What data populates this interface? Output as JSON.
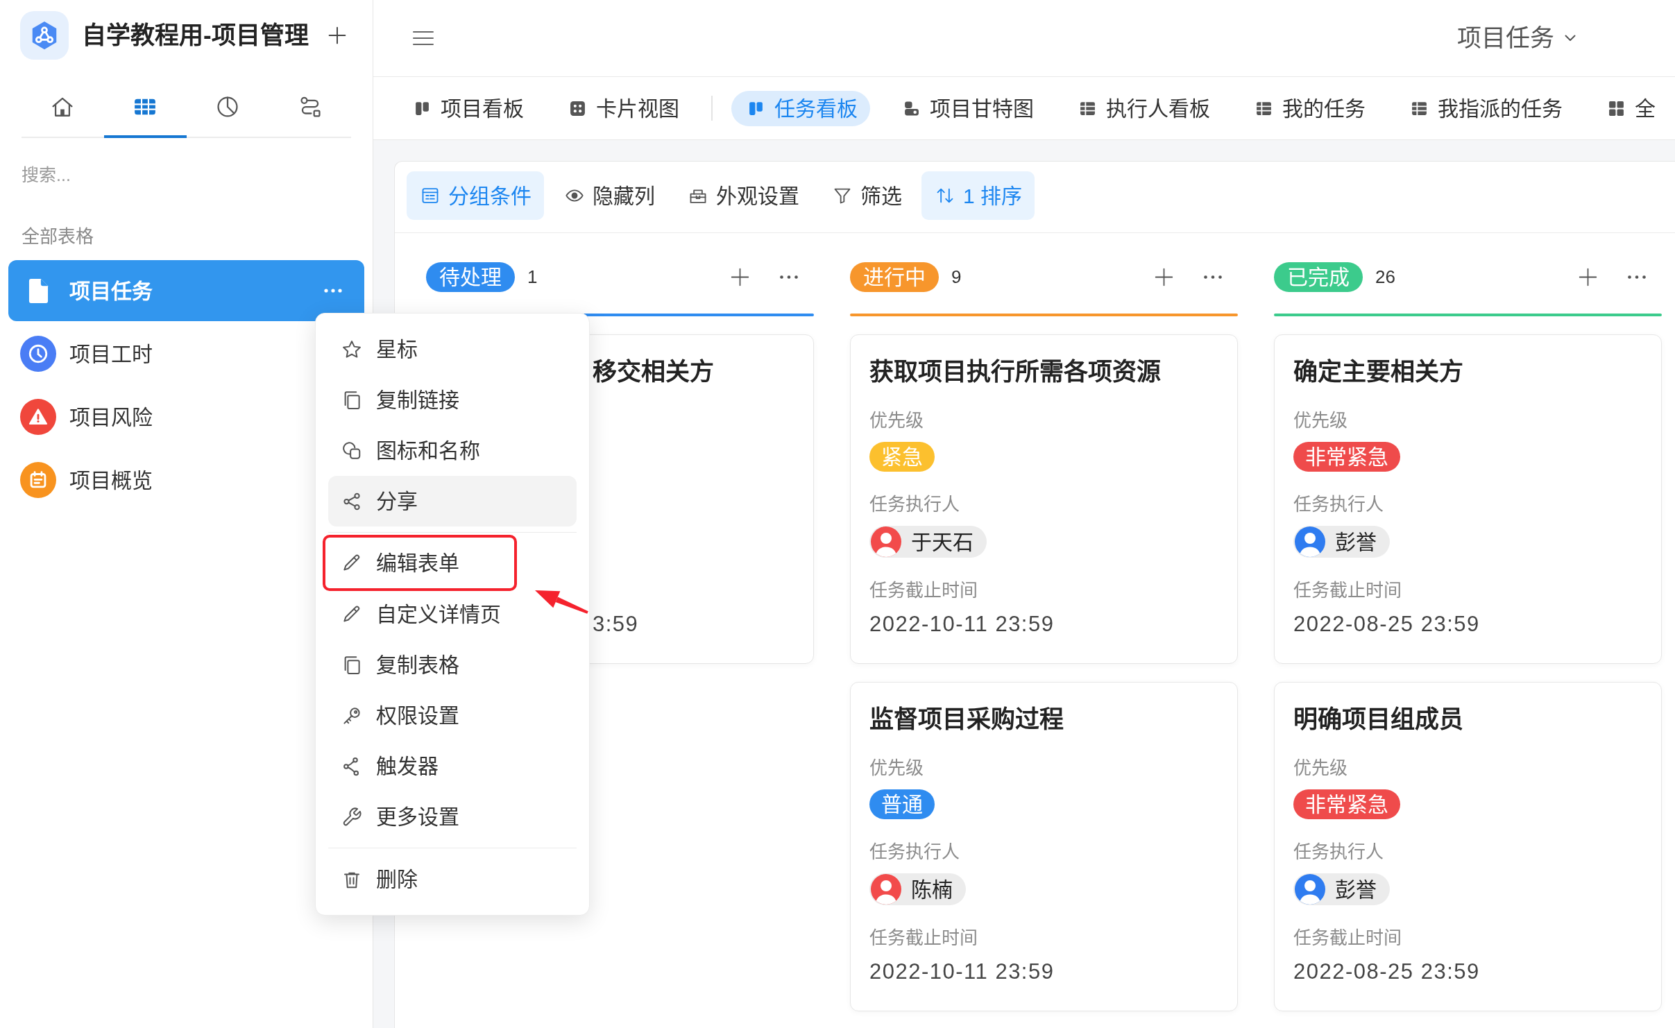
{
  "sidebar": {
    "app_title": "自学教程用-项目管理",
    "nav_tabs": [
      {
        "selected": false
      },
      {
        "selected": true
      },
      {
        "selected": false
      },
      {
        "selected": false
      }
    ],
    "search": {
      "placeholder": "搜索..."
    },
    "section_title": "全部表格",
    "items": [
      {
        "label": "项目任务",
        "selected": true
      },
      {
        "label": "项目工时",
        "selected": false,
        "color": "#4a7df5"
      },
      {
        "label": "项目风险",
        "selected": false,
        "color": "#f0473c"
      },
      {
        "label": "项目概览",
        "selected": false,
        "color": "#f8931f"
      }
    ]
  },
  "context_menu": {
    "sections": [
      [
        {
          "label": "星标",
          "hovered": false,
          "boxed": false
        },
        {
          "label": "复制链接",
          "hovered": false,
          "boxed": false
        },
        {
          "label": "图标和名称",
          "hovered": false,
          "boxed": false
        },
        {
          "label": "分享",
          "hovered": true,
          "boxed": false
        }
      ],
      [
        {
          "label": "编辑表单",
          "hovered": false,
          "boxed": true
        },
        {
          "label": "自定义详情页",
          "hovered": false,
          "boxed": false
        },
        {
          "label": "复制表格",
          "hovered": false,
          "boxed": false
        },
        {
          "label": "权限设置",
          "hovered": false,
          "boxed": false
        },
        {
          "label": "触发器",
          "hovered": false,
          "boxed": false
        },
        {
          "label": "更多设置",
          "hovered": false,
          "boxed": false
        }
      ],
      [
        {
          "label": "删除",
          "hovered": false,
          "boxed": false
        }
      ]
    ]
  },
  "topbar": {
    "table_selector": "项目任务"
  },
  "view_tab_groups": [
    [
      {
        "kind": "kanban",
        "label": "项目看板",
        "selected": false
      },
      {
        "kind": "gallery",
        "label": "卡片视图",
        "selected": false
      }
    ],
    [
      {
        "kind": "kanban",
        "label": "任务看板",
        "selected": true
      },
      {
        "kind": "gantt",
        "label": "项目甘特图",
        "selected": false
      },
      {
        "kind": "table",
        "label": "执行人看板",
        "selected": false
      },
      {
        "kind": "table",
        "label": "我的任务",
        "selected": false
      },
      {
        "kind": "table",
        "label": "我指派的任务",
        "selected": false
      },
      {
        "kind": "grid",
        "label": "全",
        "selected": false
      }
    ]
  ],
  "toolbar": [
    {
      "label": "分组条件",
      "active": true
    },
    {
      "label": "隐藏列",
      "active": false
    },
    {
      "label": "外观设置",
      "active": false
    },
    {
      "label": "筛选",
      "active": false
    },
    {
      "label": "1 排序",
      "active": true
    }
  ],
  "columns": [
    {
      "status": "待处理",
      "color": "#2f8cf0",
      "count": "1",
      "cards": [
        {
          "title": "移交相关方",
          "covered": true,
          "fields": [
            {
              "kind": "text",
              "value": "3:59"
            }
          ]
        }
      ]
    },
    {
      "status": "进行中",
      "color": "#f7962c",
      "count": "9",
      "cards": [
        {
          "title": "获取项目执行所需各项资源",
          "covered": false,
          "fields": [
            {
              "kind": "badge",
              "label": "优先级",
              "value": "紧急",
              "color": "#fcc02e"
            },
            {
              "kind": "person",
              "label": "任务执行人",
              "value": "于天石",
              "color": "#f24b4b"
            },
            {
              "kind": "text",
              "label": "任务截止时间",
              "value": "2022-10-11 23:59"
            }
          ]
        },
        {
          "title": "监督项目采购过程",
          "covered": false,
          "fields": [
            {
              "kind": "badge",
              "label": "优先级",
              "value": "普通",
              "color": "#2f8cf0"
            },
            {
              "kind": "person",
              "label": "任务执行人",
              "value": "陈楠",
              "color": "#f24b4b"
            },
            {
              "kind": "text",
              "label": "任务截止时间",
              "value": "2022-10-11 23:59"
            }
          ]
        }
      ]
    },
    {
      "status": "已完成",
      "color": "#3ccb8c",
      "count": "26",
      "cards": [
        {
          "title": "确定主要相关方",
          "covered": false,
          "fields": [
            {
              "kind": "badge",
              "label": "优先级",
              "value": "非常紧急",
              "color": "#ef4b4b"
            },
            {
              "kind": "person",
              "label": "任务执行人",
              "value": "彭誉",
              "color": "#2f7cf0"
            },
            {
              "kind": "text",
              "label": "任务截止时间",
              "value": "2022-08-25 23:59"
            }
          ]
        },
        {
          "title": "明确项目组成员",
          "covered": false,
          "fields": [
            {
              "kind": "badge",
              "label": "优先级",
              "value": "非常紧急",
              "color": "#ef4b4b"
            },
            {
              "kind": "person",
              "label": "任务执行人",
              "value": "彭誉",
              "color": "#2f7cf0"
            },
            {
              "kind": "text",
              "label": "任务截止时间",
              "value": "2022-08-25 23:59"
            }
          ]
        }
      ]
    }
  ]
}
